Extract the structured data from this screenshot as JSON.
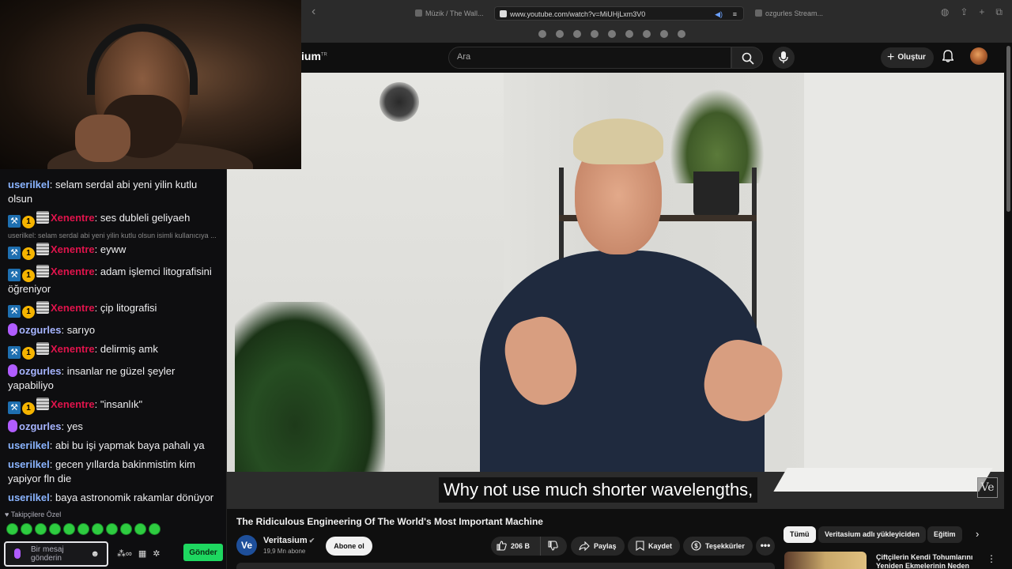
{
  "browser": {
    "tabs": [
      {
        "label": "Müzik / The Wall...",
        "active": false
      },
      {
        "label": "www.youtube.com/watch?v=MiUHjLxm3V0",
        "active": true
      },
      {
        "label": "ozgurles Stream...",
        "active": false
      }
    ]
  },
  "youtube": {
    "logo_text": "ium",
    "logo_tr": "TR",
    "search_placeholder": "Ara",
    "create_label": "Oluştur",
    "video": {
      "subtitle": "Why not use much shorter wavelengths,",
      "watermark": "Ve",
      "title": "The Ridiculous Engineering Of The World's Most Important Machine"
    },
    "channel": {
      "avatar_text": "Ve",
      "name": "Veritasium",
      "subscribers": "19,9 Mn abone",
      "subscribe_label": "Abone ol"
    },
    "actions": {
      "likes": "206 B",
      "share": "Paylaş",
      "save": "Kaydet",
      "thanks": "Teşekkürler",
      "more": "•••"
    },
    "chips": [
      "Tümü",
      "Veritasium adlı yükleyiciden",
      "Eğitim"
    ],
    "recommendation": {
      "title": "Çiftçilerin Kendi Tohumlarını Yeniden Ekmelerinin Neden"
    }
  },
  "chat": {
    "messages": [
      {
        "user": "userilkel",
        "text": ": selam serdal abi yeni yilin kutlu olsun",
        "color": "blue",
        "badges": []
      },
      {
        "user": "Xenentre",
        "text": ": ses dubleli geliyaeh",
        "color": "red",
        "badges": [
          "hammer",
          "one",
          "img"
        ]
      },
      {
        "user": "Xenentre",
        "text": ": eyww",
        "color": "red",
        "badges": [
          "hammer",
          "one",
          "img"
        ],
        "reply": "userilkel: selam serdal abi yeni yilin kutlu olsun isimli kullanıcıya ..."
      },
      {
        "user": "Xenentre",
        "text": ": adam işlemci litografisini öğreniyor",
        "color": "red",
        "badges": [
          "hammer",
          "one",
          "img"
        ]
      },
      {
        "user": "Xenentre",
        "text": ": çip litografisi",
        "color": "red",
        "badges": [
          "hammer",
          "one",
          "img"
        ]
      },
      {
        "user": "ozgurles",
        "text": ": sarıyo",
        "color": "purple",
        "badges": [
          "mic"
        ]
      },
      {
        "user": "Xenentre",
        "text": ": delirmiş amk",
        "color": "red",
        "badges": [
          "hammer",
          "one",
          "img"
        ]
      },
      {
        "user": "ozgurles",
        "text": ": insanlar ne güzel şeyler yapabiliyo",
        "color": "purple",
        "badges": [
          "mic"
        ]
      },
      {
        "user": "Xenentre",
        "text": ": \"insanlık\"",
        "color": "red",
        "badges": [
          "hammer",
          "one",
          "img"
        ]
      },
      {
        "user": "ozgurles",
        "text": ": yes",
        "color": "purple",
        "badges": [
          "mic"
        ]
      },
      {
        "user": "userilkel",
        "text": ": abi bu işi yapmak baya pahalı ya",
        "color": "blue",
        "badges": []
      },
      {
        "user": "userilkel",
        "text": ": gecen yıllarda bakinmistim kim yapiyor fln die",
        "color": "blue",
        "badges": []
      },
      {
        "user": "userilkel",
        "text": ": baya astronomik rakamlar dönüyor",
        "color": "blue",
        "badges": []
      }
    ],
    "follower_mode": "Takipçilere Özel",
    "input_placeholder": "Bir mesaj gönderin",
    "send_label": "Gönder",
    "badge_one_text": "1",
    "badge_hammer_text": "⚒"
  }
}
